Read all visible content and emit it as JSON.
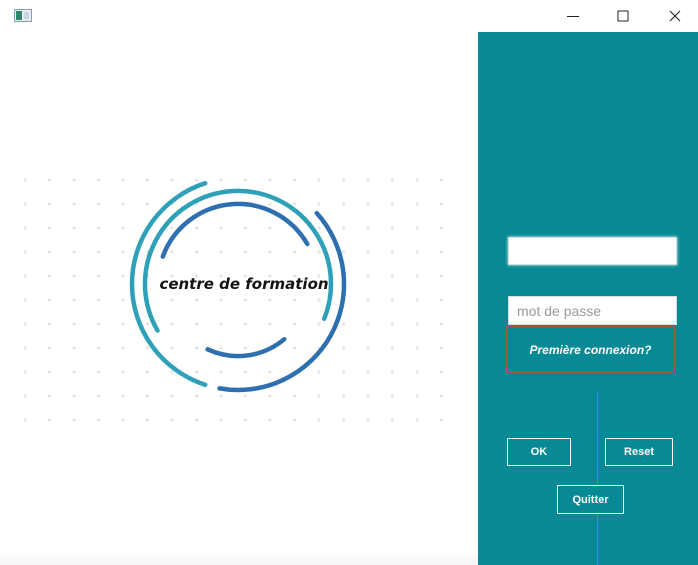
{
  "window": {
    "controls": {
      "minimize_icon": "minimize-icon",
      "maximize_icon": "maximize-icon",
      "close_icon": "close-icon"
    }
  },
  "logo": {
    "text": "centre de formation",
    "colors": {
      "teal": "#2ea1b8",
      "blue": "#2e6fb0",
      "dots": "#e3e5e7"
    }
  },
  "login": {
    "panel_color": "#078a95",
    "username": {
      "value": "",
      "placeholder": ""
    },
    "password": {
      "value": "",
      "placeholder": "mot de passe"
    },
    "first_login_link": "Première connexion?",
    "ok_label": "OK",
    "reset_label": "Reset",
    "quit_label": "Quitter"
  }
}
